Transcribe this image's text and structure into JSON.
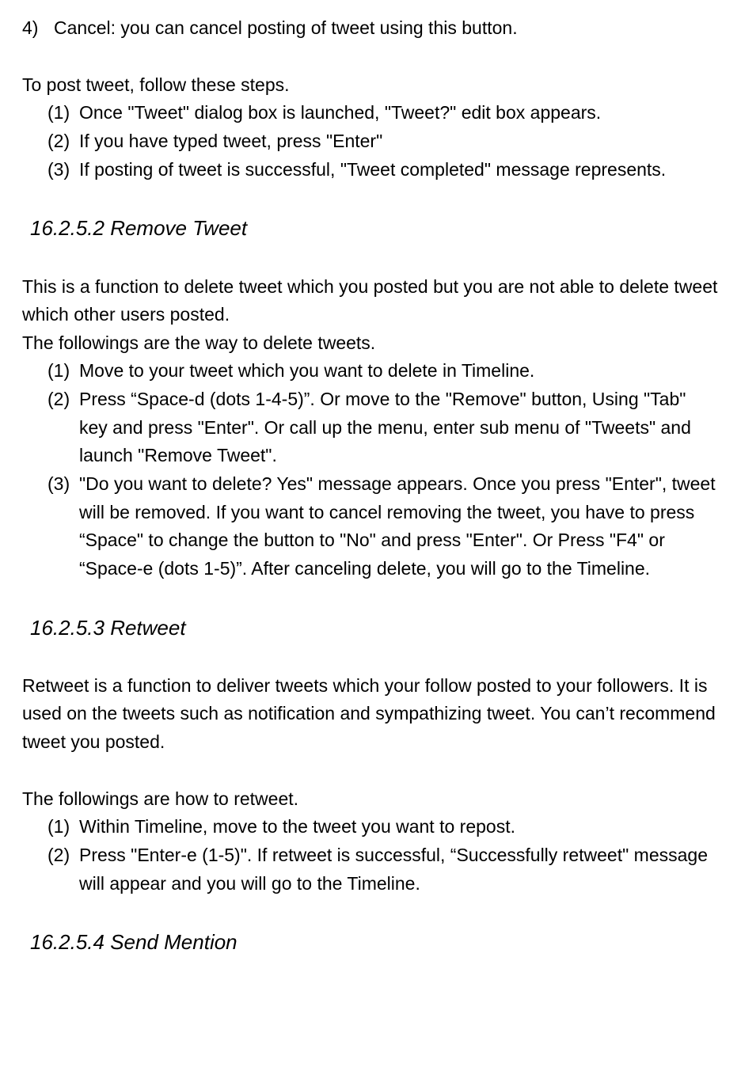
{
  "intro": {
    "item4_marker": "4)",
    "item4_text": "Cancel: you can cancel posting of tweet using this button.",
    "post_intro": "To post tweet, follow these steps.",
    "step1_marker": "(1)",
    "step1_text": "Once \"Tweet\" dialog box is launched, \"Tweet?\" edit box appears.",
    "step2_marker": "(2)",
    "step2_text": "If you have typed tweet, press \"Enter\"",
    "step3_marker": "(3)",
    "step3_text": "If posting of tweet is successful, \"Tweet completed\" message represents."
  },
  "remove": {
    "heading": "16.2.5.2 Remove Tweet",
    "p1": "This is a function to delete tweet which you posted but you are not able to delete tweet which other users posted.",
    "p2": "The followings are the way to delete tweets.",
    "step1_marker": "(1)",
    "step1_text": "Move to your tweet which you want to delete in Timeline.",
    "step2_marker": "(2)",
    "step2_text": "Press “Space-d (dots 1-4-5)”. Or move to the \"Remove\" button, Using \"Tab\" key and press \"Enter\". Or call up the menu, enter sub menu of \"Tweets\" and launch \"Remove Tweet\".",
    "step3_marker": "(3)",
    "step3_text": "\"Do you want to delete? Yes\" message appears. Once you press \"Enter\", tweet will be removed. If you want to cancel removing the tweet, you have to press “Space\" to change the button to \"No\" and press \"Enter\". Or Press \"F4\" or “Space-e (dots 1-5)”. After canceling delete, you will go to the Timeline."
  },
  "retweet": {
    "heading": "16.2.5.3 Retweet",
    "p1": "Retweet is a function to deliver tweets which your follow posted to your followers. It is used on the tweets such as notification and sympathizing tweet. You can’t recommend tweet you posted.",
    "p2": "The followings are how to retweet.",
    "step1_marker": "(1)",
    "step1_text": "Within Timeline, move to the tweet you want to repost.",
    "step2_marker": "(2)",
    "step2_text": "Press \"Enter-e (1-5)\". If retweet is successful, “Successfully retweet\" message will appear and you will go to the Timeline."
  },
  "mention": {
    "heading": "16.2.5.4 Send Mention"
  }
}
